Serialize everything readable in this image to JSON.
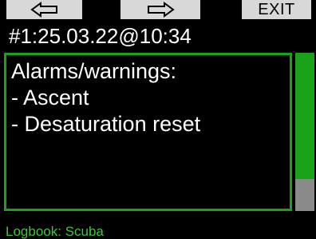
{
  "softkeys": {
    "left_icon": "arrow-left-icon",
    "middle_icon": "arrow-right-icon",
    "right_label": "EXIT"
  },
  "dive_title": "#1:25.03.22@10:34",
  "alarms": {
    "heading": "Alarms/warnings:",
    "items": [
      "- Ascent",
      "- Desaturation reset"
    ]
  },
  "scrollbar": {
    "position_fraction": 0.0,
    "visible_fraction": 0.8
  },
  "footer": {
    "label": "Logbook: Scuba"
  },
  "colors": {
    "accent_green": "#1aa31a",
    "footer_green": "#3dc43d",
    "softkey_bg": "#d8d8d8",
    "scroll_track": "#8a8a8a",
    "background": "#000000"
  }
}
